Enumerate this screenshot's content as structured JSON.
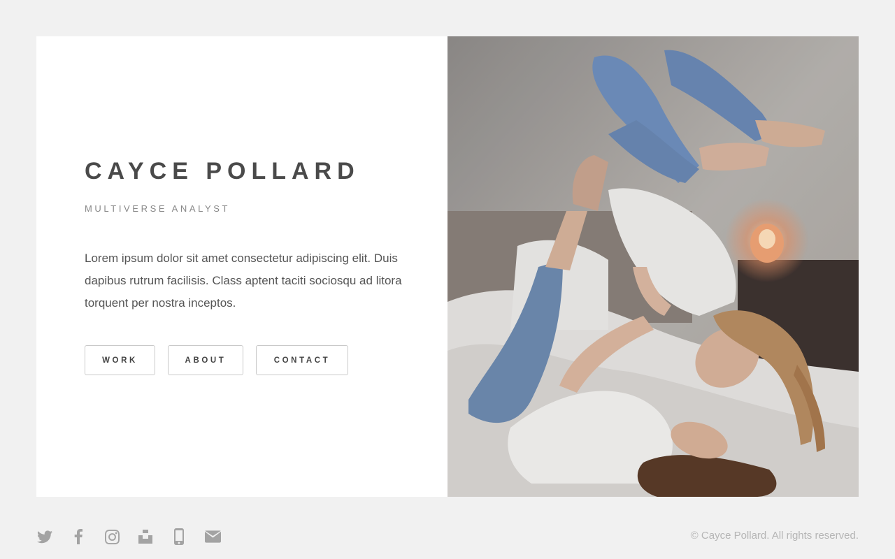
{
  "profile": {
    "name": "CAYCE POLLARD",
    "title": "MULTIVERSE ANALYST",
    "bio": "Lorem ipsum dolor sit amet consectetur adipiscing elit. Duis dapibus rutrum facilisis. Class aptent taciti sociosqu ad litora torquent per nostra inceptos."
  },
  "nav": {
    "work": "WORK",
    "about": "ABOUT",
    "contact": "CONTACT"
  },
  "footer": {
    "social_icons": [
      "twitter-icon",
      "facebook-icon",
      "instagram-icon",
      "unsplash-icon",
      "phone-icon",
      "mail-icon"
    ],
    "copyright": "© Cayce Pollard. All rights reserved."
  },
  "colors": {
    "background": "#f1f1f1",
    "card": "#ffffff",
    "heading": "#4a4a4a",
    "icon": "#a3a3a3"
  }
}
